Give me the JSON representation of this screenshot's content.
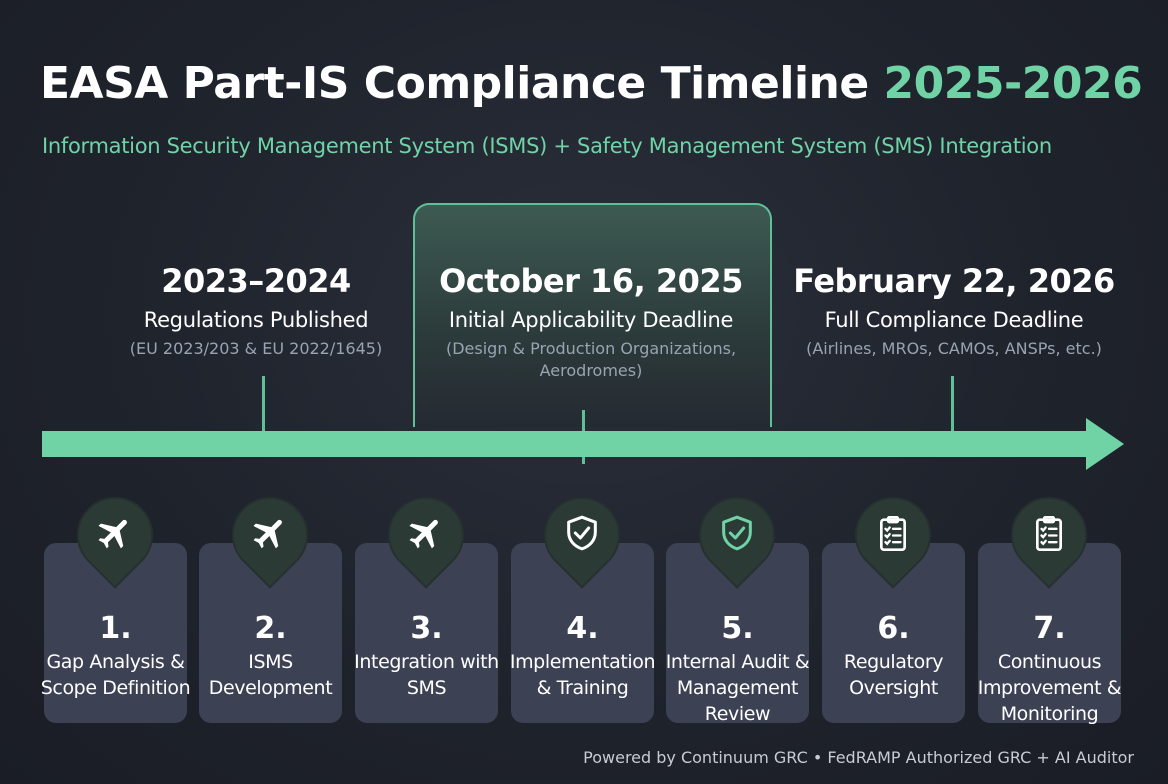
{
  "header": {
    "title": "EASA Part-IS Compliance Timeline",
    "title_year": "2025-2026",
    "subtitle": "Information Security Management System (ISMS) + Safety Management System (SMS) Integration"
  },
  "milestones": [
    {
      "date": "2023–2024",
      "label": "Regulations Published",
      "note": "(EU 2023/203 & EU 2022/1645)",
      "highlighted": false
    },
    {
      "date": "October 16, 2025",
      "label": "Initial Applicability Deadline",
      "note": "(Design & Production Organizations, Aerodromes)",
      "highlighted": true
    },
    {
      "date": "February 22, 2026",
      "label": "Full Compliance Deadline",
      "note": "(Airlines, MROs, CAMOs, ANSPs, etc.)",
      "highlighted": false
    }
  ],
  "steps": [
    {
      "number": "1.",
      "label": "Gap Analysis & Scope Definition",
      "icon": "airplane-icon"
    },
    {
      "number": "2.",
      "label": "ISMS Development",
      "icon": "airplane-icon"
    },
    {
      "number": "3.",
      "label": "Integration with SMS",
      "icon": "airplane-icon"
    },
    {
      "number": "4.",
      "label": "Implementation & Training",
      "icon": "shield-check-icon"
    },
    {
      "number": "5.",
      "label": "Internal Audit & Management Review",
      "icon": "shield-check-icon"
    },
    {
      "number": "6.",
      "label": "Regulatory Oversight",
      "icon": "clipboard-checklist-icon"
    },
    {
      "number": "7.",
      "label": "Continuous Improvement & Monitoring",
      "icon": "clipboard-checklist-icon"
    }
  ],
  "footer": "Powered by Continuum GRC • FedRAMP Authorized GRC + AI Auditor",
  "colors": {
    "accent": "#6fd3a6",
    "background": "#1f232c",
    "card": "#3c4154"
  }
}
